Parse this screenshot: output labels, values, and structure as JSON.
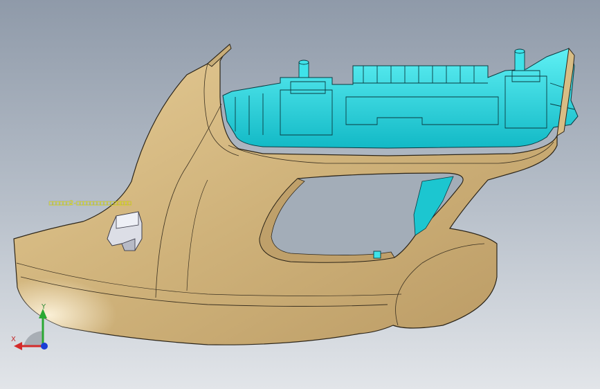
{
  "viewport": {
    "background_top": "#8f9aa9",
    "background_bottom": "#e2e5e9",
    "part_color": "#d8bd85",
    "insert_color": "#1fd9e3",
    "stub_color": "#d9dbe3"
  },
  "annotation": {
    "text": "□□□□□□2-□□□□□□□□□□□□□□□□"
  },
  "triad": {
    "x_label": "X",
    "y_label": "Y",
    "x_color": "#d42a2a",
    "y_color": "#2aa832",
    "z_color": "#1a3fd6"
  }
}
